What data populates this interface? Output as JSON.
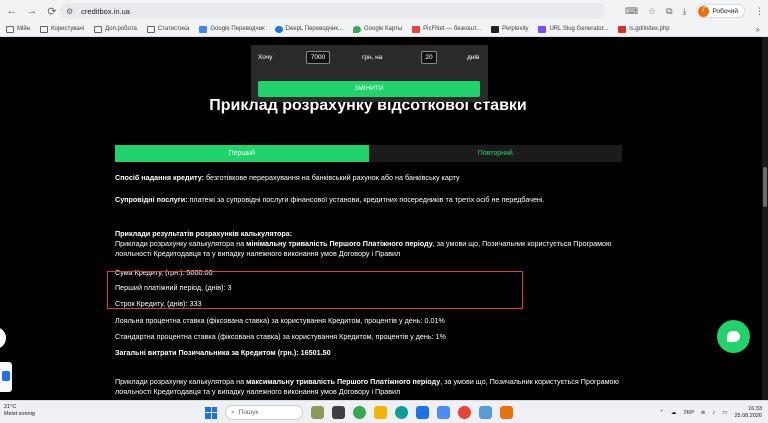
{
  "browser": {
    "url": "creditbox.in.ua",
    "profile_initial": "Г",
    "profile_label": "Робочий"
  },
  "bookmarks": [
    {
      "label": "Мійн",
      "icon": "folder-icon"
    },
    {
      "label": "Користувачі",
      "icon": "folder-icon"
    },
    {
      "label": "Доп.робота",
      "icon": "folder-icon"
    },
    {
      "label": "Статистика",
      "icon": "folder-icon"
    },
    {
      "label": "Google Переводчик",
      "icon": "google-translate-icon"
    },
    {
      "label": "DeepL Переводчик...",
      "icon": "deepl-icon"
    },
    {
      "label": "Google Карты",
      "icon": "google-maps-icon"
    },
    {
      "label": "PicFNet — безкошт...",
      "icon": "picfnet-icon"
    },
    {
      "label": "Perplexity",
      "icon": "perplexity-icon"
    },
    {
      "label": "URL Slug Generator...",
      "icon": "url-slug-icon"
    },
    {
      "label": "is.gd/index.php",
      "icon": "isgd-icon"
    }
  ],
  "calculator": {
    "want_label": "Хочу",
    "amount": "7000",
    "currency_label": "грн, на",
    "days": "20",
    "days_label": "днів",
    "button": "ЗМІНИТИ"
  },
  "heading": "Приклад розрахунку відсоткової ставки",
  "tabs": [
    {
      "label": "Перший",
      "active": true
    },
    {
      "label": "Повторний",
      "active": false
    }
  ],
  "content": {
    "method_label": "Спосіб надання кредиту:",
    "method_text": " безготівкове перерахування на банківський рахунок або на банківську карту",
    "services_label": "Супровідні послуги:",
    "services_text": " платежі за супровідні послуги фінансової установи, кредитних посередників та третіх осіб не передбачені.",
    "examples_heading": "Приклади результатів розрахунків калькулятора:",
    "example_intro_a": "Приклади розрахунку калькулятора на ",
    "example_intro_b": "мінімальну тривалість Першого Платіжного періоду",
    "example_intro_c": ", за умови що, Позичальник користується Програмою лояльності Кредитодавця та у випадку належного виконання умов Договору і Правил",
    "sum": "Сума Кредиту, (грн.): 5000.00",
    "first_period": "Перший платіжний період, (днів): 3",
    "term": "Строк Кредиту, (днів): 333",
    "loyal_rate": "Лояльна процентна ставка (фіксована ставка) за користування Кредитом, процентів у день: 0.01%",
    "standard_rate": "Стандартна процентна ставка (фіксована ставка) за користування Кредитом, процентів у день: 1%",
    "total_cost": "Загальні витрати Позичальника за Кредитом (грн.): 16501.50",
    "example2_a": "Приклади розрахунку калькулятора на ",
    "example2_b": "максимальну тривалість Першого Платіжного періоду",
    "example2_c": ", за умови що, Позичальник користується Програмою лояльності Кредитодавця та у випадку належного виконання умов Договору і Правил"
  },
  "taskbar": {
    "temperature": "21°C",
    "weather": "Meist sonnig",
    "search_placeholder": "Пошук",
    "language": "УКР",
    "time": "16:33",
    "date": "25.08.2026"
  },
  "colors": {
    "accent_green": "#20d36a",
    "highlight_red": "#e53935"
  }
}
